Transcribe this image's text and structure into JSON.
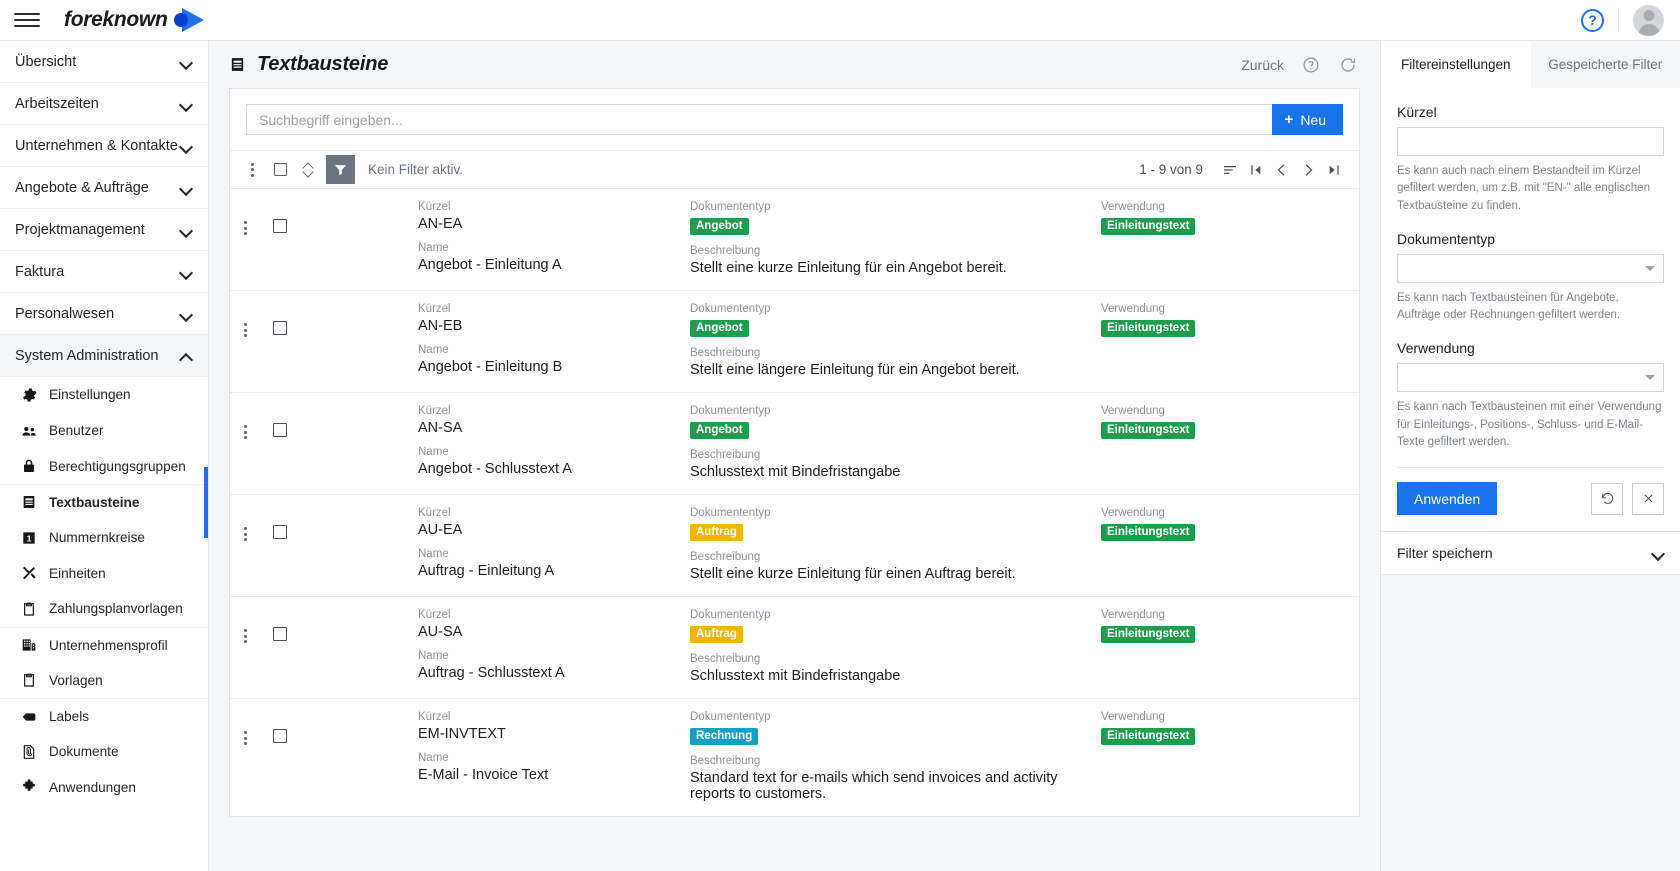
{
  "topbar": {
    "menu_icon": "hamburger-icon",
    "brand": "foreknown",
    "help_icon": "help-circle-icon",
    "avatar_icon": "user-avatar-icon"
  },
  "sidebar": {
    "groups": [
      {
        "label": "Übersicht",
        "state": "collapsed"
      },
      {
        "label": "Arbeitszeiten",
        "state": "collapsed"
      },
      {
        "label": "Unternehmen & Kontakte",
        "state": "collapsed"
      },
      {
        "label": "Angebote & Aufträge",
        "state": "collapsed"
      },
      {
        "label": "Projektmanagement",
        "state": "collapsed"
      },
      {
        "label": "Faktura",
        "state": "collapsed"
      },
      {
        "label": "Personalwesen",
        "state": "collapsed"
      },
      {
        "label": "System Administration",
        "state": "expanded"
      }
    ],
    "items": [
      {
        "label": "Einstellungen",
        "icon": "gear-icon",
        "active": false
      },
      {
        "label": "Benutzer",
        "icon": "users-icon",
        "active": false
      },
      {
        "label": "Berechtigungsgruppen",
        "icon": "lock-icon",
        "active": false
      },
      {
        "label": "Textbausteine",
        "icon": "text-block-icon",
        "active": true
      },
      {
        "label": "Nummernkreise",
        "icon": "number-one-icon",
        "active": false
      },
      {
        "label": "Einheiten",
        "icon": "tools-icon",
        "active": false
      },
      {
        "label": "Zahlungsplanvorlagen",
        "icon": "clipboard-icon",
        "active": false
      },
      {
        "label": "Unternehmensprofil",
        "icon": "building-icon",
        "active": false
      },
      {
        "label": "Vorlagen",
        "icon": "clipboard-icon",
        "active": false
      },
      {
        "label": "Labels",
        "icon": "tag-icon",
        "active": false
      },
      {
        "label": "Dokumente",
        "icon": "document-icon",
        "active": false
      },
      {
        "label": "Anwendungen",
        "icon": "puzzle-icon",
        "active": false
      }
    ]
  },
  "page": {
    "title": "Textbausteine",
    "title_icon": "text-block-icon",
    "back_label": "Zurück",
    "help_icon": "help-circle-icon",
    "refresh_icon": "refresh-icon"
  },
  "search": {
    "value": "",
    "placeholder": "Suchbegriff eingeben...",
    "new_label": "Neu",
    "new_icon": "plus-icon"
  },
  "list_toolbar": {
    "menu_icon": "dots-vertical-icon",
    "select_all_icon": "checkbox-icon",
    "sort_toggle_icon": "up-down-arrows-icon",
    "filter_icon": "filter-icon",
    "filter_status": "Kein Filter aktiv.",
    "pager_count": "1 - 9 von 9",
    "sort_icon": "sort-icon",
    "first_page_icon": "first-page-icon",
    "prev_page_icon": "prev-page-icon",
    "next_page_icon": "next-page-icon",
    "last_page_icon": "last-page-icon"
  },
  "field_labels": {
    "kuerzel": "Kürzel",
    "dokumententyp": "Dokumententyp",
    "verwendung": "Verwendung",
    "name": "Name",
    "beschreibung": "Beschreibung"
  },
  "badge_colors": {
    "Angebot": "#1f9d4e",
    "Auftrag": "#f0b400",
    "Rechnung": "#14a0c4",
    "Einleitungstext": "#1f9d4e"
  },
  "rows": [
    {
      "kuerzel": "AN-EA",
      "dokumententyp": "Angebot",
      "verwendung": "Einleitungstext",
      "name": "Angebot - Einleitung A",
      "beschreibung": "Stellt eine kurze Einleitung für ein Angebot bereit."
    },
    {
      "kuerzel": "AN-EB",
      "dokumententyp": "Angebot",
      "verwendung": "Einleitungstext",
      "name": "Angebot - Einleitung B",
      "beschreibung": "Stellt eine längere Einleitung für ein Angebot bereit."
    },
    {
      "kuerzel": "AN-SA",
      "dokumententyp": "Angebot",
      "verwendung": "Einleitungstext",
      "name": "Angebot - Schlusstext A",
      "beschreibung": "Schlusstext mit Bindefristangabe"
    },
    {
      "kuerzel": "AU-EA",
      "dokumententyp": "Auftrag",
      "verwendung": "Einleitungstext",
      "name": "Auftrag - Einleitung A",
      "beschreibung": "Stellt eine kurze Einleitung für einen Auftrag bereit."
    },
    {
      "kuerzel": "AU-SA",
      "dokumententyp": "Auftrag",
      "verwendung": "Einleitungstext",
      "name": "Auftrag - Schlusstext A",
      "beschreibung": "Schlusstext mit Bindefristangabe"
    },
    {
      "kuerzel": "EM-INVTEXT",
      "dokumententyp": "Rechnung",
      "verwendung": "Einleitungstext",
      "name": "E-Mail - Invoice Text",
      "beschreibung": "Standard text for e-mails which send invoices and activity reports to customers."
    }
  ],
  "filters": {
    "tab_settings": "Filtereinstellungen",
    "tab_saved": "Gespeicherte Filter",
    "kuerzel_label": "Kürzel",
    "kuerzel_value": "",
    "kuerzel_hint": "Es kann auch nach einem Bestandteil im Kürzel gefiltert werden, um z.B. mit \"EN-\" alle englischen Textbausteine zu finden.",
    "dokumententyp_label": "Dokumententyp",
    "dokumententyp_value": "",
    "dokumententyp_hint": "Es kann nach Textbausteinen für Angebote, Aufträge oder Rechnungen gefiltert werden.",
    "verwendung_label": "Verwendung",
    "verwendung_value": "",
    "verwendung_hint": "Es kann nach Textbausteinen mit einer Verwendung für Einleitungs-, Positions-, Schluss- und E-Mail-Texte gefiltert werden.",
    "apply_label": "Anwenden",
    "reset_icon": "undo-icon",
    "clear_icon": "close-icon",
    "save_label": "Filter speichern",
    "save_chevron_icon": "chevron-down-icon"
  }
}
